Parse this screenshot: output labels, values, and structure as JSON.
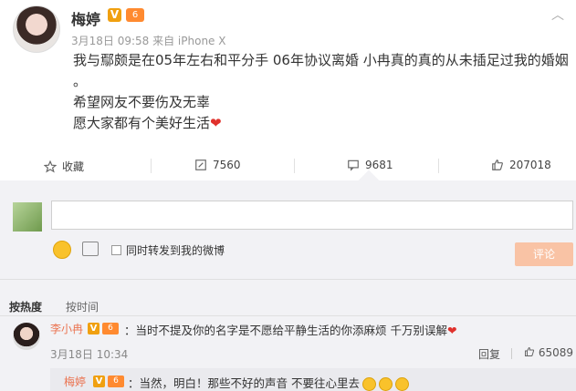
{
  "post": {
    "author": "梅婷",
    "verified_badge": "V",
    "level_badge": "6",
    "meta": "3月18日 09:58 来自 iPhone X",
    "lines": [
      "我与鄢颇是在05年左右和平分手  06年协议离婚 小冉真的真的从未插足过我的婚姻 。",
      "希望网友不要伤及无辜",
      "愿大家都有个美好生活"
    ],
    "heart": "❤"
  },
  "actions": {
    "favorite": "收藏",
    "repost": "7560",
    "comment": "9681",
    "like": "207018"
  },
  "composer": {
    "placeholder": "",
    "also_repost": "同时转发到我的微博",
    "submit": "评论"
  },
  "sort_tabs": {
    "hot": "按热度",
    "time": "按时间"
  },
  "comments": [
    {
      "author": "李小冉",
      "text": "：当时不提及你的名字是不愿给平静生活的你添麻烦 千万别误解",
      "time": "3月18日 10:34",
      "reply": "回复",
      "likes": "65089"
    }
  ],
  "sub_reply": {
    "author": "梅婷",
    "text": "：当然，明白！那些不好的声音  不要往心里去"
  },
  "colors": {
    "accent_orange": "#eb7350",
    "vip_gold": "#f0a010",
    "submit_disabled": "#f9c3a5"
  }
}
